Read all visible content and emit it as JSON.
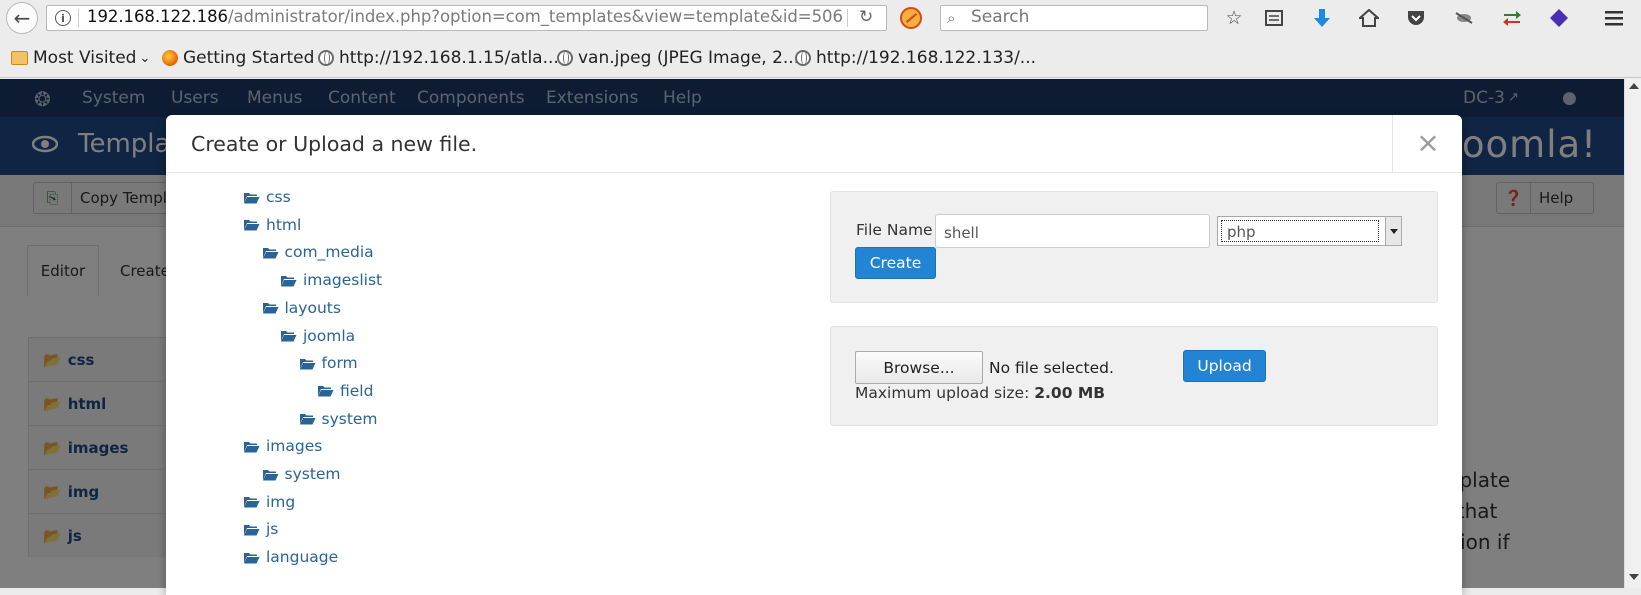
{
  "browser": {
    "url_host": "192.168.122.186",
    "url_path": "/administrator/index.php?option=com_templates&view=template&id=506",
    "search_placeholder": "Search",
    "bookmarks": [
      {
        "label": "Most Visited",
        "icon": "folder-icon"
      },
      {
        "label": "Getting Started",
        "icon": "firefox-icon"
      },
      {
        "label": "http://192.168.1.15/atla...",
        "icon": "globe-icon"
      },
      {
        "label": "van.jpeg (JPEG Image, 2...",
        "icon": "globe-icon"
      },
      {
        "label": "http://192.168.122.133/...",
        "icon": "globe-icon"
      }
    ],
    "toolbar_icons": [
      "star-icon",
      "reader-icon",
      "download-icon",
      "home-icon",
      "pocket-icon",
      "extension-icon",
      "sync-icon",
      "addon-icon",
      "menu-icon"
    ]
  },
  "joomla": {
    "topnav": [
      "System",
      "Users",
      "Menus",
      "Content",
      "Components",
      "Extensions",
      "Help"
    ],
    "site_name": "DC-3",
    "page_title": "Templat",
    "logo_text": "oomla!",
    "copy_template_label": "Copy Templ",
    "help_label": "Help",
    "tabs": [
      "Editor",
      "Create"
    ],
    "tree": [
      "css",
      "html",
      "images",
      "img",
      "js"
    ],
    "side_text": [
      "mplate",
      "s that",
      "ation if"
    ]
  },
  "modal": {
    "title": "Create or Upload a new file.",
    "close_label": "×",
    "tree": [
      {
        "label": "css",
        "depth": 0
      },
      {
        "label": "html",
        "depth": 0
      },
      {
        "label": "com_media",
        "depth": 1
      },
      {
        "label": "imageslist",
        "depth": 2
      },
      {
        "label": "layouts",
        "depth": 1
      },
      {
        "label": "joomla",
        "depth": 2
      },
      {
        "label": "form",
        "depth": 3
      },
      {
        "label": "field",
        "depth": 4
      },
      {
        "label": "system",
        "depth": 3
      },
      {
        "label": "images",
        "depth": 0
      },
      {
        "label": "system",
        "depth": 1
      },
      {
        "label": "img",
        "depth": 0
      },
      {
        "label": "js",
        "depth": 0
      },
      {
        "label": "language",
        "depth": 0
      }
    ],
    "create": {
      "file_name_label": "File Name",
      "file_name_value": "shell",
      "extension_value": "php",
      "create_label": "Create"
    },
    "upload": {
      "browse_label": "Browse...",
      "no_file_label": "No file selected.",
      "upload_label": "Upload",
      "max_upload_label": "Maximum upload size:",
      "max_upload_value": "2.00 MB"
    }
  },
  "colors": {
    "accent": "#2384d3",
    "link": "#2a6496",
    "joomla_nav": "#1a3867",
    "joomla_header": "#1f4a86"
  }
}
